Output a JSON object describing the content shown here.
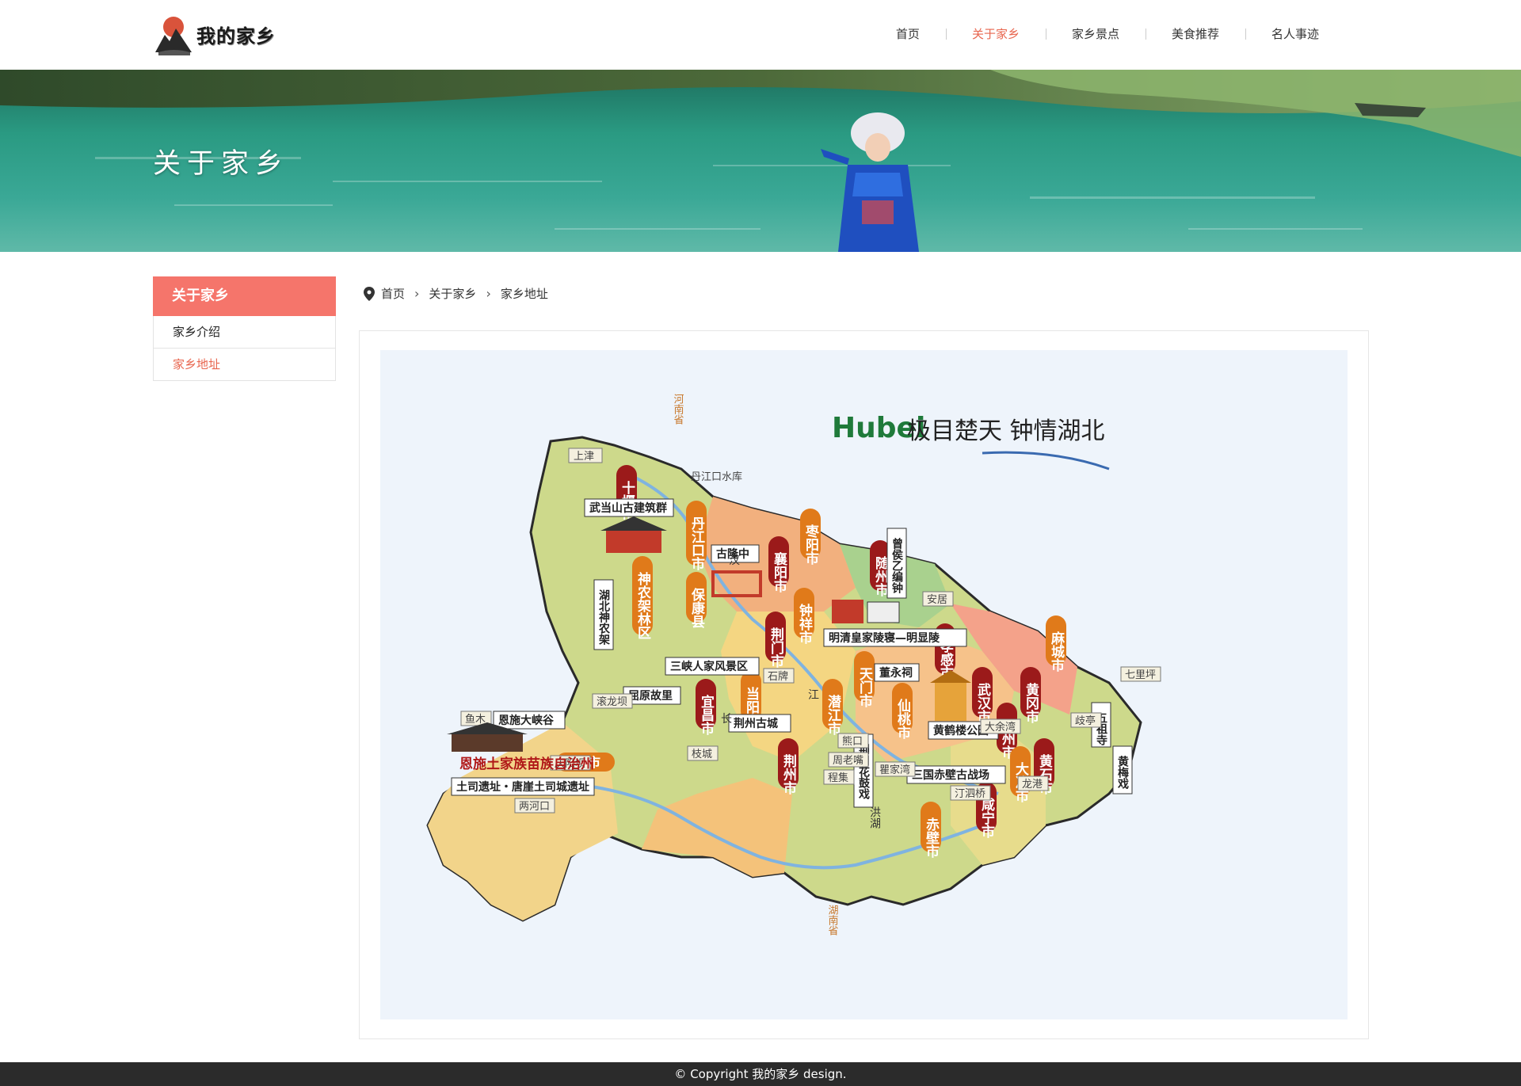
{
  "header": {
    "logo_text": "我的家乡",
    "nav": [
      "首页",
      "关于家乡",
      "家乡景点",
      "美食推荐",
      "名人事迹"
    ]
  },
  "banner": {
    "title": "关于家乡"
  },
  "sidebar": {
    "heading": "关于家乡",
    "items": [
      {
        "label": "家乡介绍"
      },
      {
        "label": "家乡地址"
      }
    ]
  },
  "breadcrumb": {
    "items": [
      "首页",
      "关于家乡",
      "家乡地址"
    ]
  },
  "map": {
    "slogan": "极目楚天 钟情湖北",
    "brand": "Hubei",
    "cities": [
      "十堰市",
      "襄阳市",
      "随州市",
      "荆门市",
      "孝感市",
      "天门市",
      "麻城市",
      "宜昌市",
      "当阳市",
      "潜江市",
      "仙桃市",
      "武汉市",
      "黄冈市",
      "鄂州市",
      "黄石市",
      "荆州市",
      "大冶市",
      "咸宁市",
      "赤壁市",
      "恩施市",
      "丹江口市",
      "保康县",
      "枣阳市",
      "钟祥市",
      "神农架林区"
    ],
    "sights": [
      "武当山古建筑群",
      "古隆中",
      "明清皇家陵寝—明显陵",
      "三峡人家风景区",
      "屈原故里",
      "荆州古城",
      "黄鹤楼公园",
      "三国赤壁古战场",
      "恩施大峡谷",
      "土司遗址・唐崖土司城遗址",
      "湖北神农架",
      "曾侯乙编钟",
      "董永祠",
      "荆州花鼓戏",
      "五祖寺",
      "黄梅戏"
    ],
    "places": [
      "上津",
      "丹江口水库",
      "安居",
      "七里坪",
      "歧亭",
      "大余湾",
      "石牌",
      "枝城",
      "鱼木",
      "滚龙坝",
      "庆阳坝",
      "两河口",
      "熊口",
      "周老嘴",
      "程集",
      "瞿家湾",
      "汀泗桥",
      "龙港"
    ],
    "region_label": "恩施土家族苗族自治州",
    "neighbors": [
      "河南省",
      "湖南省"
    ],
    "rivers": [
      "汉",
      "江",
      "长",
      "洪湖"
    ]
  },
  "footer": {
    "text": "©  Copyright  我的家乡  design."
  }
}
